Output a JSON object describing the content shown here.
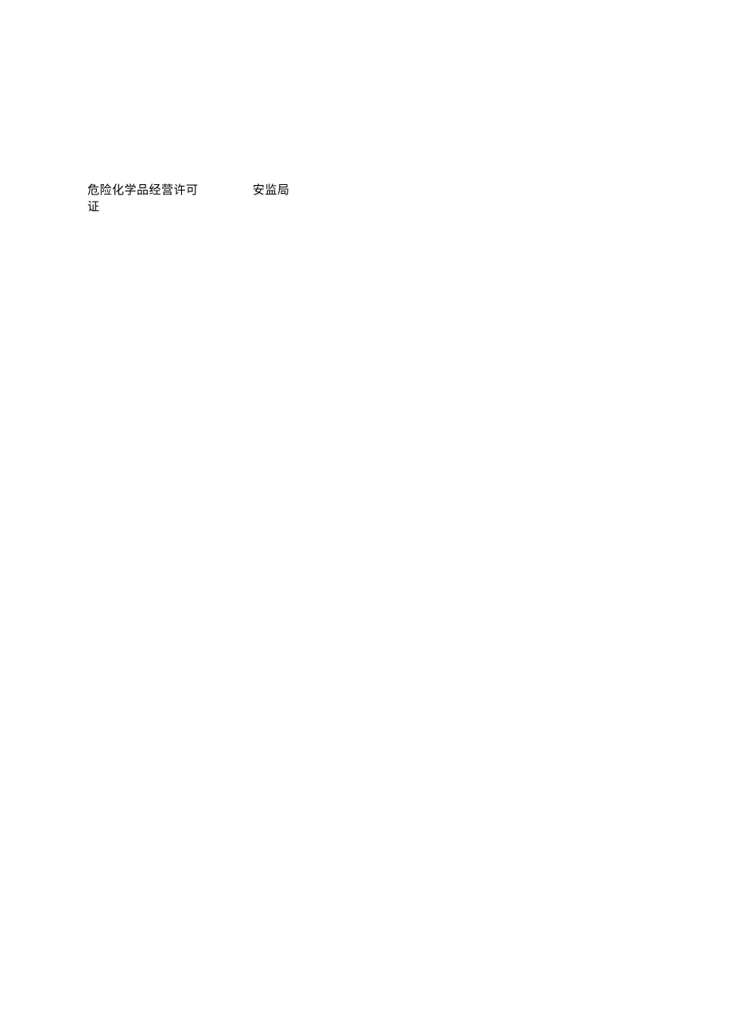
{
  "document": {
    "permit_name": "危险化学品经营许可证",
    "agency_name": "安监局"
  }
}
